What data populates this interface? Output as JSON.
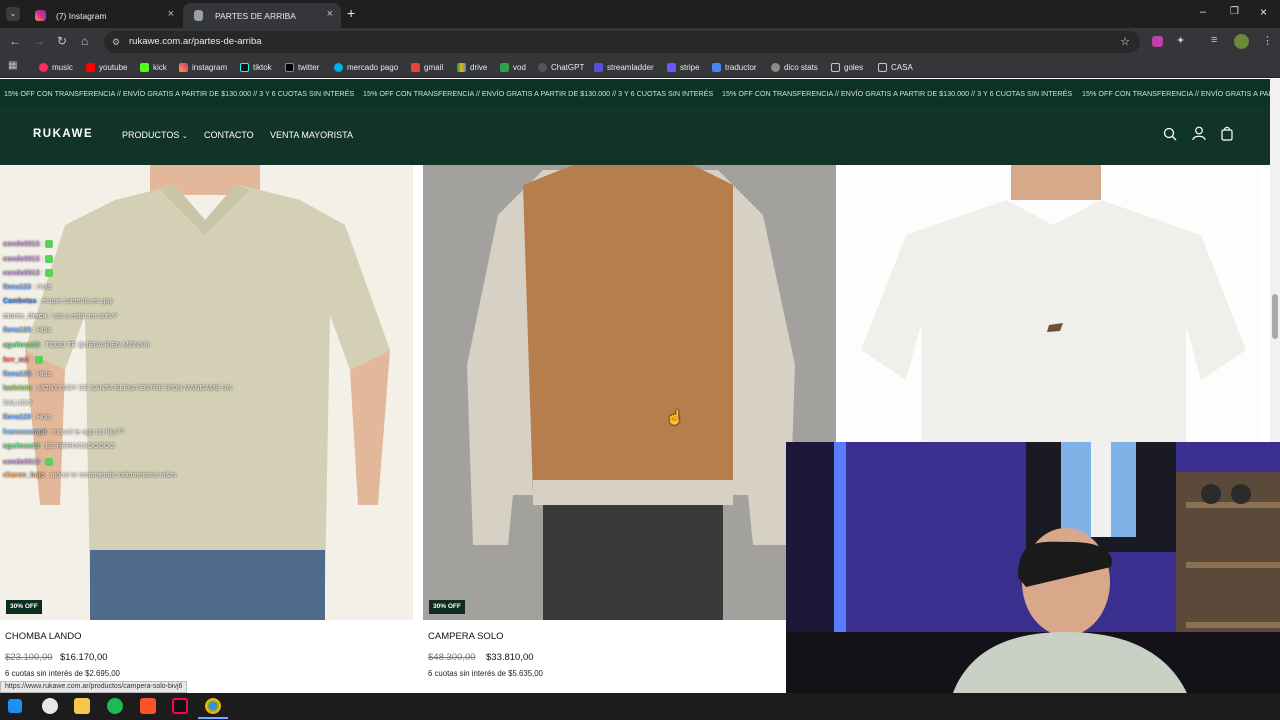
{
  "browser": {
    "tabs": [
      {
        "label": "(7) Instagram",
        "active": false
      },
      {
        "label": "PARTES DE ARRIBA",
        "active": true
      }
    ],
    "url": "rukawe.com.ar/partes-de-arriba",
    "bookmarks": [
      "music",
      "youtube",
      "kick",
      "instagram",
      "tiktok",
      "twitter",
      "mercado pago",
      "gmail",
      "drive",
      "vod",
      "ChatGPT",
      "streamladder",
      "stripe",
      "traductor",
      "dico stats",
      "goles",
      "CASA"
    ],
    "status_url": "https://www.rukawe.com.ar/productos/campera-solo-bivj6"
  },
  "site": {
    "promo": "15% OFF CON TRANSFERENCIA // ENVÍO GRATIS A PARTIR DE $130.000 // 3 Y 6 CUOTAS SIN INTERÉS",
    "promo_cut": "15% OFF CON TRANSFERENCIA // ENVÍO GRATIS A PART",
    "logo": "RUKAWE",
    "nav": [
      "PRODUCTOS",
      "CONTACTO",
      "VENTA MAYORISTA"
    ],
    "products": [
      {
        "name": "CHOMBA LANDO",
        "badge": "30% OFF",
        "old_price": "$23.100,00",
        "price": "$16.170,00",
        "cuotas": "6 cuotas sin interés de $2.695,00"
      },
      {
        "name": "CAMPERA SOLO",
        "badge": "30% OFF",
        "old_price": "$48.300,00",
        "price": "$33.810,00",
        "cuotas": "6 cuotas sin interés de $5.635,00"
      }
    ]
  },
  "chat": [
    {
      "user": "condo0013",
      "msg": "",
      "color": "#c8a0d8"
    },
    {
      "user": "condo0013",
      "msg": "",
      "color": "#c8a0d8"
    },
    {
      "user": "condo0013",
      "msg": "",
      "color": "#c8a0d8"
    },
    {
      "user": "llona123",
      "msg": "Hola",
      "color": "#7fb0ff"
    },
    {
      "user": "Cambetas",
      "msg": "el que comenta es gay",
      "color": "#3f8cff"
    },
    {
      "user": "moree_derca",
      "msg": "vas a estar en ontiv?",
      "color": "#e6e6e6"
    },
    {
      "user": "llona123",
      "msg": "Hola",
      "color": "#7fb0ff"
    },
    {
      "user": "aguitosa13",
      "msg": "TODO TE QUEDA BIEN MONXIII",
      "color": "#7fdc8f"
    },
    {
      "user": "ferr_m2",
      "msg": "",
      "color": "#ff7b7b"
    },
    {
      "user": "llona123",
      "msg": "Hola",
      "color": "#7fb0ff"
    },
    {
      "user": "laoleiota",
      "msg": "MONXI SOY DE SANTA ELENA ENTRE RIOS MANDAME UN",
      "color": "#9cd86a"
    },
    {
      "user": "",
      "msg": "SALUDO",
      "color": "#e6e6e6"
    },
    {
      "user": "llona123",
      "msg": "Hola",
      "color": "#7fb0ff"
    },
    {
      "user": "francocamp8",
      "msg": "monxii te ago un hijo??",
      "color": "#7fc8ff"
    },
    {
      "user": "aguitosa13",
      "msg": "ES HERMOSOOOOO",
      "color": "#7fdc8f"
    },
    {
      "user": "condo0013",
      "msg": "",
      "color": "#c8a0d8"
    },
    {
      "user": "charon_bajo",
      "msg": "monxi te recomiendo indumentaria m&m",
      "color": "#ffb060"
    }
  ],
  "colors": {
    "promo_bg": "#0c3226",
    "nav_bg": "#113426",
    "badge_bg": "#0b2e21"
  }
}
